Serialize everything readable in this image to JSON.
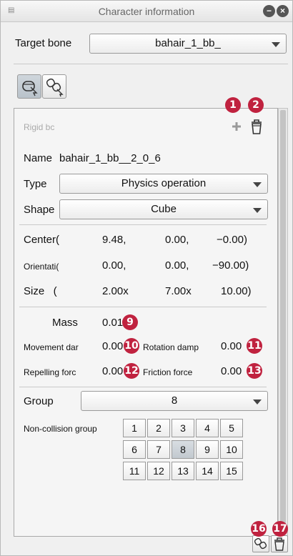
{
  "titlebar": {
    "title": "Character information"
  },
  "target_bone": {
    "label": "Target bone",
    "value": "bahair_1_bb_"
  },
  "rigid_body": {
    "header_label": "Rigid bc",
    "name_label": "Name",
    "name_value": "bahair_1_bb__2_0_6",
    "type_label": "Type",
    "type_value": "Physics operation",
    "shape_label": "Shape",
    "shape_value": "Cube",
    "center": {
      "label": "Center(",
      "v1": "9.48,",
      "v2": "0.00,",
      "v3": "−0.00)"
    },
    "orientation": {
      "label": "Orientati(",
      "v1": "0.00,",
      "v2": "0.00,",
      "v3": "−90.00)"
    },
    "size": {
      "label": "Size   (",
      "v1": "2.00x",
      "v2": "7.00x",
      "v3": "10.00)"
    },
    "mass": {
      "label": "Mass",
      "value": "0.01"
    },
    "movement_damping": {
      "label": "Movement dar",
      "value": "0.00"
    },
    "rotation_damping": {
      "label": "Rotation damp",
      "value": "0.00"
    },
    "repelling_force": {
      "label": "Repelling forc",
      "value": "0.00"
    },
    "friction_force": {
      "label": "Friction force",
      "value": "0.00"
    },
    "group_label": "Group",
    "group_value": "8",
    "non_collision_label": "Non-collision group",
    "non_collision_groups": [
      "1",
      "2",
      "3",
      "4",
      "5",
      "6",
      "7",
      "8",
      "9",
      "10",
      "11",
      "12",
      "13",
      "14",
      "15"
    ],
    "selected_group": "8"
  },
  "badges": {
    "b1": "1",
    "b2": "2",
    "b9": "9",
    "b10": "10",
    "b11": "11",
    "b12": "12",
    "b13": "13",
    "b16": "16",
    "b17": "17"
  },
  "icons": {
    "minimize": "minimize-icon",
    "close": "close-icon",
    "add": "plus-icon",
    "delete": "trash-icon"
  },
  "colors": {
    "badge": "#c0223f",
    "panel_bg": "#f0f0f0"
  }
}
